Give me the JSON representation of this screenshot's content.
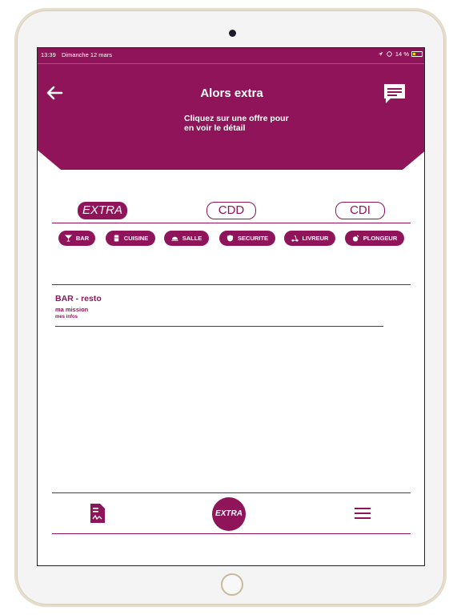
{
  "status_bar": {
    "time": "13:39",
    "date": "Dimanche 12 mars",
    "battery": "14 %"
  },
  "header": {
    "title": "Alors extra",
    "subtitle": "Cliquez sur une offre pour en voir le détail"
  },
  "tabs": [
    {
      "label": "EXTRA",
      "active": true
    },
    {
      "label": "CDD",
      "active": false
    },
    {
      "label": "CDI",
      "active": false
    }
  ],
  "categories": [
    {
      "label": "BAR",
      "icon": "cocktail-icon"
    },
    {
      "label": "CUISINE",
      "icon": "fridge-icon"
    },
    {
      "label": "SALLE",
      "icon": "cloche-icon"
    },
    {
      "label": "SECURITE",
      "icon": "shield-icon"
    },
    {
      "label": "LIVREUR",
      "icon": "scooter-icon"
    },
    {
      "label": "PLONGEUR",
      "icon": "dish-icon"
    }
  ],
  "offers": [
    {
      "title": "BAR - resto",
      "mission": "ma mission",
      "infos": "mes infos"
    }
  ],
  "bottom_nav": {
    "center_label": "EXTRA"
  },
  "colors": {
    "brand": "#8f1459",
    "background": "#ffffff"
  }
}
